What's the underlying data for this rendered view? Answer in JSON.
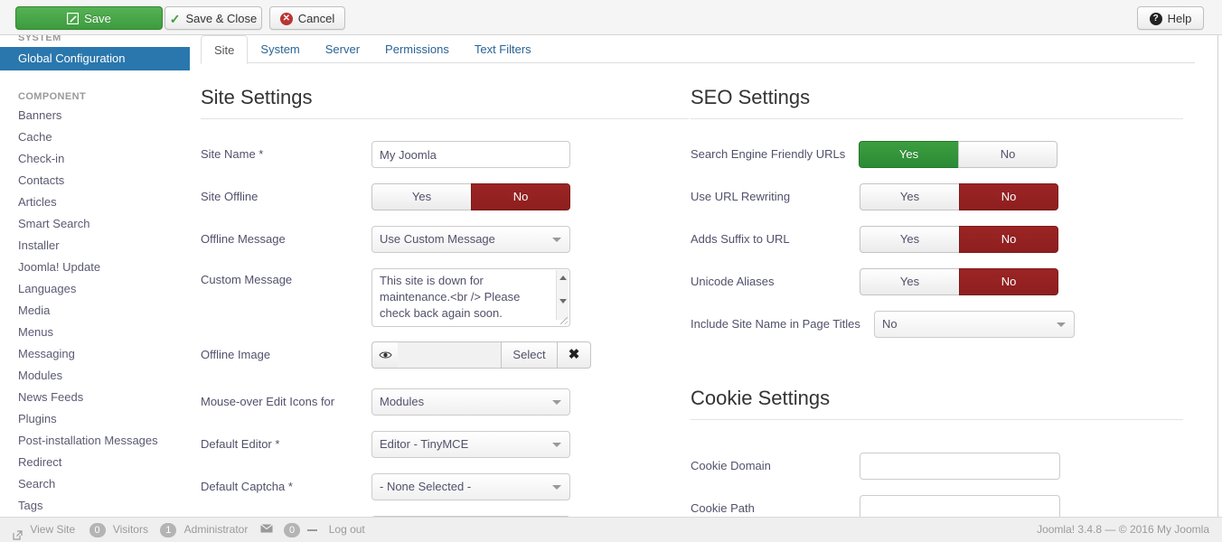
{
  "toolbar": {
    "save_label": "Save",
    "save_close_label": "Save & Close",
    "cancel_label": "Cancel",
    "help_label": "Help",
    "save_icon": "pencil-square-icon",
    "save_close_icon": "check-icon",
    "cancel_icon": "cancel-circle-icon",
    "help_icon": "question-circle-icon",
    "save_color": "#3d9c3f"
  },
  "sidebar": {
    "system_heading": "SYSTEM",
    "system_items": [
      {
        "label": "Global Configuration",
        "active": true
      }
    ],
    "component_heading": "COMPONENT",
    "component_items": [
      {
        "label": "Banners"
      },
      {
        "label": "Cache"
      },
      {
        "label": "Check-in"
      },
      {
        "label": "Contacts"
      },
      {
        "label": "Articles"
      },
      {
        "label": "Smart Search"
      },
      {
        "label": "Installer"
      },
      {
        "label": "Joomla! Update"
      },
      {
        "label": "Languages"
      },
      {
        "label": "Media"
      },
      {
        "label": "Menus"
      },
      {
        "label": "Messaging"
      },
      {
        "label": "Modules"
      },
      {
        "label": "News Feeds"
      },
      {
        "label": "Plugins"
      },
      {
        "label": "Post-installation Messages"
      },
      {
        "label": "Redirect"
      },
      {
        "label": "Search"
      },
      {
        "label": "Tags"
      }
    ],
    "active_color": "#2a77ad"
  },
  "tabs": [
    {
      "label": "Site",
      "active": true
    },
    {
      "label": "System",
      "active": false
    },
    {
      "label": "Server",
      "active": false
    },
    {
      "label": "Permissions",
      "active": false
    },
    {
      "label": "Text Filters",
      "active": false
    }
  ],
  "site_settings": {
    "title": "Site Settings",
    "site_name": {
      "label": "Site Name *",
      "value": "My Joomla"
    },
    "site_offline": {
      "label": "Site Offline",
      "yes": "Yes",
      "no": "No",
      "selected": "No"
    },
    "offline_message": {
      "label": "Offline Message",
      "value": "Use Custom Message"
    },
    "custom_message": {
      "label": "Custom Message",
      "value": "This site is down for maintenance.<br /> Please check back again soon."
    },
    "offline_image": {
      "label": "Offline Image",
      "value": "",
      "preview_icon": "eye-icon",
      "select_label": "Select",
      "clear_label": "✖"
    },
    "mouseover_edit": {
      "label": "Mouse-over Edit Icons for",
      "value": "Modules"
    },
    "default_editor": {
      "label": "Default Editor *",
      "value": "Editor - TinyMCE"
    },
    "default_captcha": {
      "label": "Default Captcha *",
      "value": "- None Selected -"
    }
  },
  "seo_settings": {
    "title": "SEO Settings",
    "sef_urls": {
      "label": "Search Engine Friendly URLs",
      "yes": "Yes",
      "no": "No",
      "selected": "Yes"
    },
    "url_rewriting": {
      "label": "Use URL Rewriting",
      "yes": "Yes",
      "no": "No",
      "selected": "No"
    },
    "url_suffix": {
      "label": "Adds Suffix to URL",
      "yes": "Yes",
      "no": "No",
      "selected": "No"
    },
    "unicode_aliases": {
      "label": "Unicode Aliases",
      "yes": "Yes",
      "no": "No",
      "selected": "No"
    },
    "site_name_in_titles": {
      "label": "Include Site Name in Page Titles",
      "value": "No"
    },
    "yes_color": "#2a8b35",
    "no_color": "#8e1f1f"
  },
  "cookie_settings": {
    "title": "Cookie Settings",
    "cookie_domain": {
      "label": "Cookie Domain",
      "value": ""
    },
    "cookie_path": {
      "label": "Cookie Path",
      "value": ""
    }
  },
  "statusbar": {
    "view_site_icon": "external-link-icon",
    "view_site": "View Site",
    "visitors_count": "0",
    "visitors_label": "Visitors",
    "admin_count": "1",
    "admin_label": "Administrator",
    "mail_icon": "envelope-icon",
    "messages_count": "0",
    "logout_label": "Log out",
    "copyright": "Joomla! 3.4.8  —  © 2016 My Joomla"
  }
}
